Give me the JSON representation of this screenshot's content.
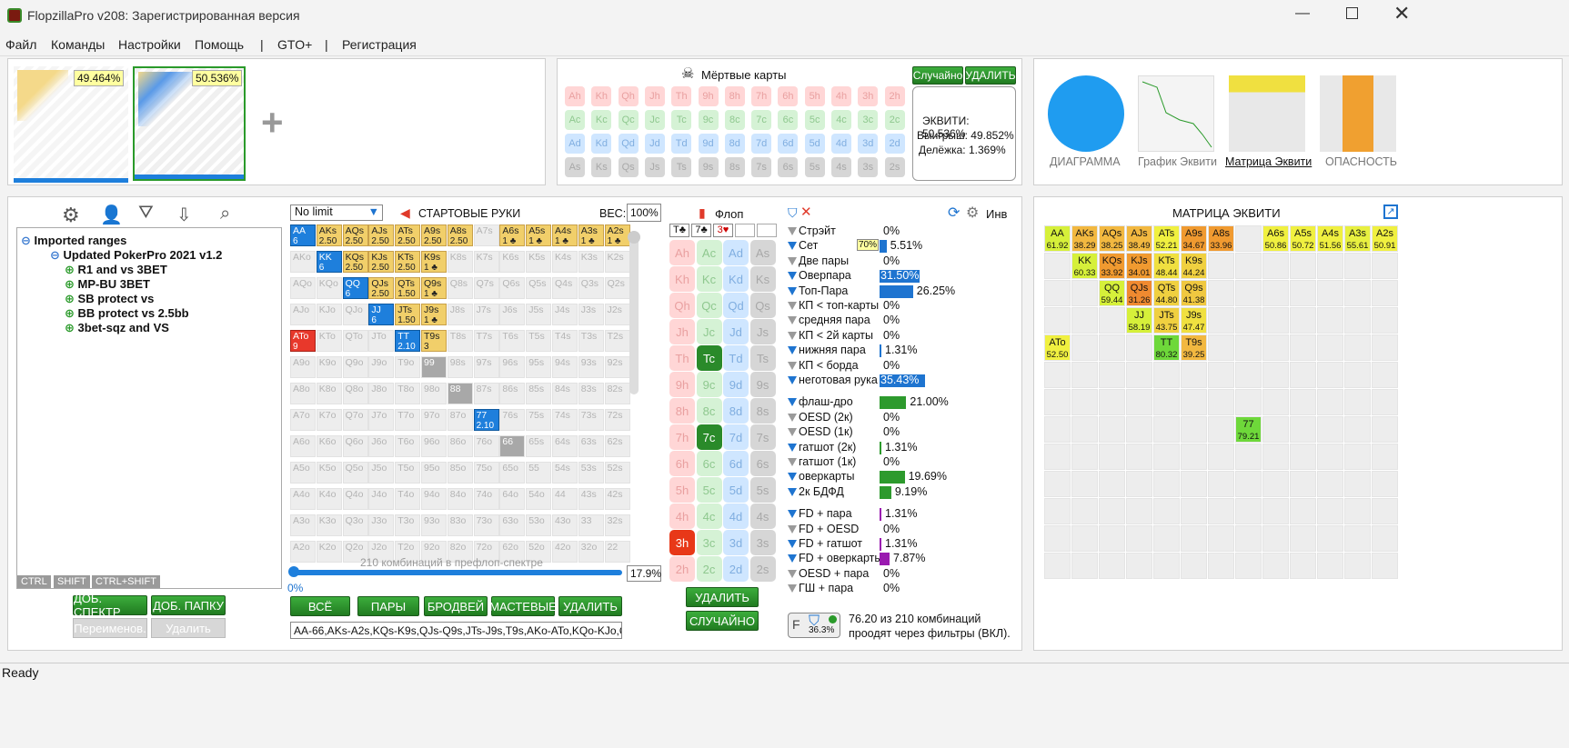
{
  "window": {
    "title": "FlopzillaPro v208: Зарегистрированная версия"
  },
  "menu": [
    "Файл",
    "Команды",
    "Настройки",
    "Помощь",
    "|",
    "GTO+",
    "|",
    "Регистрация"
  ],
  "players": [
    {
      "equity": "49.464%"
    },
    {
      "equity": "50.536%"
    }
  ],
  "dead": {
    "title": "Мёртвые карты",
    "random": "Случайно",
    "delete": "УДАЛИТЬ",
    "rows": [
      [
        "Ah",
        "Kh",
        "Qh",
        "Jh",
        "Th",
        "9h",
        "8h",
        "7h",
        "6h",
        "5h",
        "4h",
        "3h",
        "2h"
      ],
      [
        "Ac",
        "Kc",
        "Qc",
        "Jc",
        "Tc",
        "9c",
        "8c",
        "7c",
        "6c",
        "5c",
        "4c",
        "3c",
        "2c"
      ],
      [
        "Ad",
        "Kd",
        "Qd",
        "Jd",
        "Td",
        "9d",
        "8d",
        "7d",
        "6d",
        "5d",
        "4d",
        "3d",
        "2d"
      ],
      [
        "As",
        "Ks",
        "Qs",
        "Js",
        "Ts",
        "9s",
        "8s",
        "7s",
        "6s",
        "5s",
        "4s",
        "3s",
        "2s"
      ]
    ],
    "equity": "ЭКВИТИ: 50.536%",
    "win": "Выигрыш: 49.852%",
    "tie": "Делёжка: 1.369%"
  },
  "views": [
    "ДИАГРАММА",
    "График Эквити",
    "Матрица Эквити",
    "ОПАСНОСТЬ"
  ],
  "tree": {
    "items": [
      "Imported ranges",
      "Updated PokerPro 2021 v1.2",
      "R1 and vs 3BET",
      "MP-BU 3BET",
      "SB protect vs",
      "BB protect vs 2.5bb",
      "3bet-sqz and VS"
    ],
    "keys": [
      "CTRL",
      "SHIFT",
      "CTRL+SHIFT"
    ],
    "add_range": "ДОБ. СПЕКТР",
    "add_folder": "ДОБ. ПАПКУ",
    "rename": "Переименов.",
    "delete": "Удалить"
  },
  "range": {
    "mode": "No limit",
    "title": "СТАРТОВЫЕ РУКИ",
    "weight_label": "ВЕС:",
    "weight": "100%",
    "combos": "210 комбинаций в префлоп-спектре",
    "pct": "17.9%",
    "slider": "0%",
    "buttons": [
      "ВСЁ",
      "ПАРЫ",
      "БРОДВЕЙ",
      "МАСТЕВЫЕ",
      "УДАЛИТЬ"
    ],
    "text": "AA-66,AKs-A2s,KQs-K9s,QJs-Q9s,JTs-J9s,T9s,AKo-ATo,KQo-KJo,QJ",
    "grid": [
      [
        "AA",
        "AKs",
        "AQs",
        "AJs",
        "ATs",
        "A9s",
        "A8s",
        "A7s",
        "A6s",
        "A5s",
        "A4s",
        "A3s",
        "A2s"
      ],
      [
        "AKo",
        "KK",
        "KQs",
        "KJs",
        "KTs",
        "K9s",
        "K8s",
        "K7s",
        "K6s",
        "K5s",
        "K4s",
        "K3s",
        "K2s"
      ],
      [
        "AQo",
        "KQo",
        "QQ",
        "QJs",
        "QTs",
        "Q9s",
        "Q8s",
        "Q7s",
        "Q6s",
        "Q5s",
        "Q4s",
        "Q3s",
        "Q2s"
      ],
      [
        "AJo",
        "KJo",
        "QJo",
        "JJ",
        "JTs",
        "J9s",
        "J8s",
        "J7s",
        "J6s",
        "J5s",
        "J4s",
        "J3s",
        "J2s"
      ],
      [
        "ATo",
        "KTo",
        "QTo",
        "JTo",
        "TT",
        "T9s",
        "T8s",
        "T7s",
        "T6s",
        "T5s",
        "T4s",
        "T3s",
        "T2s"
      ],
      [
        "A9o",
        "K9o",
        "Q9o",
        "J9o",
        "T9o",
        "99",
        "98s",
        "97s",
        "96s",
        "95s",
        "94s",
        "93s",
        "92s"
      ],
      [
        "A8o",
        "K8o",
        "Q8o",
        "J8o",
        "T8o",
        "98o",
        "88",
        "87s",
        "86s",
        "85s",
        "84s",
        "83s",
        "82s"
      ],
      [
        "A7o",
        "K7o",
        "Q7o",
        "J7o",
        "T7o",
        "97o",
        "87o",
        "77",
        "76s",
        "75s",
        "74s",
        "73s",
        "72s"
      ],
      [
        "A6o",
        "K6o",
        "Q6o",
        "J6o",
        "T6o",
        "96o",
        "86o",
        "76o",
        "66",
        "65s",
        "64s",
        "63s",
        "62s"
      ],
      [
        "A5o",
        "K5o",
        "Q5o",
        "J5o",
        "T5o",
        "95o",
        "85o",
        "75o",
        "65o",
        "55",
        "54s",
        "53s",
        "52s"
      ],
      [
        "A4o",
        "K4o",
        "Q4o",
        "J4o",
        "T4o",
        "94o",
        "84o",
        "74o",
        "64o",
        "54o",
        "44",
        "43s",
        "42s"
      ],
      [
        "A3o",
        "K3o",
        "Q3o",
        "J3o",
        "T3o",
        "93o",
        "83o",
        "73o",
        "63o",
        "53o",
        "43o",
        "33",
        "32s"
      ],
      [
        "A2o",
        "K2o",
        "Q2o",
        "J2o",
        "T2o",
        "92o",
        "82o",
        "72o",
        "62o",
        "52o",
        "42o",
        "32o",
        "22"
      ]
    ],
    "weights": {
      "AA": "6",
      "AKs": "2.50",
      "AQs": "2.50",
      "AJs": "2.50",
      "ATs": "2.50",
      "A9s": "2.50",
      "A8s": "2.50",
      "A6s": "1 ♣",
      "A5s": "1 ♣",
      "A4s": "1 ♣",
      "A3s": "1 ♣",
      "A2s": "1 ♣",
      "KK": "6",
      "KQs": "2.50",
      "KJs": "2.50",
      "KTs": "2.50",
      "K9s": "1 ♣",
      "QQ": "6",
      "QJs": "2.50",
      "QTs": "1.50",
      "Q9s": "1 ♣",
      "JJ": "6",
      "JTs": "1.50",
      "J9s": "1 ♣",
      "ATo": "9",
      "TT": "2.10",
      "T9s": "3",
      "77": "2.10"
    }
  },
  "flop": {
    "title": "Флоп",
    "board": [
      "T♣",
      "7♣",
      "3♥"
    ],
    "delete": "УДАЛИТЬ",
    "random": "СЛУЧАЙНО",
    "ranks": [
      "A",
      "K",
      "Q",
      "J",
      "T",
      "9",
      "8",
      "7",
      "6",
      "5",
      "4",
      "3",
      "2"
    ]
  },
  "stats": {
    "header": "Инв",
    "filter_pct": "36.3%",
    "summary1": "76.20 из 210 комбинаций",
    "summary2": "проодят через фильтры (ВКЛ).",
    "rows": [
      {
        "label": "Стрэйт",
        "pct": "0%",
        "val": 0,
        "color": "#1e74d0"
      },
      {
        "label": "Сет",
        "pct": "5.51%",
        "val": 5.51,
        "color": "#1e74d0",
        "tag": "70%"
      },
      {
        "label": "Две пары",
        "pct": "0%",
        "val": 0,
        "color": "#1e74d0"
      },
      {
        "label": "Оверпара",
        "pct": "31.50%",
        "val": 31.5,
        "color": "#1e74d0",
        "inbar": true
      },
      {
        "label": "Топ-Пара",
        "pct": "26.25%",
        "val": 26.25,
        "color": "#1e74d0"
      },
      {
        "label": "КП < топ-карты",
        "pct": "0%",
        "val": 0,
        "color": "#1e74d0"
      },
      {
        "label": "средняя пара",
        "pct": "0%",
        "val": 0,
        "color": "#1e74d0"
      },
      {
        "label": "КП < 2й карты",
        "pct": "0%",
        "val": 0,
        "color": "#1e74d0"
      },
      {
        "label": "нижняя пара",
        "pct": "1.31%",
        "val": 1.31,
        "color": "#1e74d0"
      },
      {
        "label": "КП < борда",
        "pct": "0%",
        "val": 0,
        "color": "#1e74d0"
      },
      {
        "label": "неготовая рука",
        "pct": "35.43%",
        "val": 35.43,
        "color": "#1e74d0",
        "inbar": true
      },
      {
        "label": "флаш-дро",
        "pct": "21.00%",
        "val": 21,
        "color": "#2d9a2d"
      },
      {
        "label": "OESD (2к)",
        "pct": "0%",
        "val": 0,
        "color": "#2d9a2d"
      },
      {
        "label": "OESD (1к)",
        "pct": "0%",
        "val": 0,
        "color": "#2d9a2d"
      },
      {
        "label": "гатшот (2к)",
        "pct": "1.31%",
        "val": 1.31,
        "color": "#2d9a2d"
      },
      {
        "label": "гатшот (1к)",
        "pct": "0%",
        "val": 0,
        "color": "#2d9a2d"
      },
      {
        "label": "оверкарты",
        "pct": "19.69%",
        "val": 19.69,
        "color": "#2d9a2d"
      },
      {
        "label": "2к БДФД",
        "pct": "9.19%",
        "val": 9.19,
        "color": "#2d9a2d"
      },
      {
        "label": "FD + пара",
        "pct": "1.31%",
        "val": 1.31,
        "color": "#9a1ab0"
      },
      {
        "label": "FD + OESD",
        "pct": "0%",
        "val": 0,
        "color": "#9a1ab0"
      },
      {
        "label": "FD + гатшот",
        "pct": "1.31%",
        "val": 1.31,
        "color": "#9a1ab0"
      },
      {
        "label": "FD + оверкарты",
        "pct": "7.87%",
        "val": 7.87,
        "color": "#9a1ab0"
      },
      {
        "label": "OESD + пара",
        "pct": "0%",
        "val": 0,
        "color": "#9a1ab0"
      },
      {
        "label": "ГШ + пара",
        "pct": "0%",
        "val": 0,
        "color": "#9a1ab0"
      }
    ]
  },
  "matrix": {
    "title": "МАТРИЦА ЭКВИТИ",
    "cells": [
      {
        "h": "AA",
        "v": "61.92",
        "r": 0,
        "c": 0,
        "col": "#d6f03a"
      },
      {
        "h": "AKs",
        "v": "38.29",
        "r": 0,
        "c": 1,
        "col": "#f2b840"
      },
      {
        "h": "AQs",
        "v": "38.25",
        "r": 0,
        "c": 2,
        "col": "#f2b840"
      },
      {
        "h": "AJs",
        "v": "38.49",
        "r": 0,
        "c": 3,
        "col": "#f2b840"
      },
      {
        "h": "ATs",
        "v": "52.21",
        "r": 0,
        "c": 4,
        "col": "#f0f040"
      },
      {
        "h": "A9s",
        "v": "34.67",
        "r": 0,
        "c": 5,
        "col": "#f09a30"
      },
      {
        "h": "A8s",
        "v": "33.96",
        "r": 0,
        "c": 6,
        "col": "#f09a30"
      },
      {
        "h": "A6s",
        "v": "50.86",
        "r": 0,
        "c": 8,
        "col": "#f0f040"
      },
      {
        "h": "A5s",
        "v": "50.72",
        "r": 0,
        "c": 9,
        "col": "#f0f040"
      },
      {
        "h": "A4s",
        "v": "51.56",
        "r": 0,
        "c": 10,
        "col": "#f0f040"
      },
      {
        "h": "A3s",
        "v": "55.61",
        "r": 0,
        "c": 11,
        "col": "#e8f040"
      },
      {
        "h": "A2s",
        "v": "50.91",
        "r": 0,
        "c": 12,
        "col": "#f0f040"
      },
      {
        "h": "KK",
        "v": "60.33",
        "r": 1,
        "c": 1,
        "col": "#d6f03a"
      },
      {
        "h": "KQs",
        "v": "33.92",
        "r": 1,
        "c": 2,
        "col": "#f09a30"
      },
      {
        "h": "KJs",
        "v": "34.01",
        "r": 1,
        "c": 3,
        "col": "#f09a30"
      },
      {
        "h": "KTs",
        "v": "48.44",
        "r": 1,
        "c": 4,
        "col": "#f0e040"
      },
      {
        "h": "K9s",
        "v": "44.24",
        "r": 1,
        "c": 5,
        "col": "#f0d040"
      },
      {
        "h": "QQ",
        "v": "59.44",
        "r": 2,
        "c": 2,
        "col": "#d6f03a"
      },
      {
        "h": "QJs",
        "v": "31.26",
        "r": 2,
        "c": 3,
        "col": "#f08a30"
      },
      {
        "h": "QTs",
        "v": "44.80",
        "r": 2,
        "c": 4,
        "col": "#f0d040"
      },
      {
        "h": "Q9s",
        "v": "41.38",
        "r": 2,
        "c": 5,
        "col": "#f0c840"
      },
      {
        "h": "JJ",
        "v": "58.19",
        "r": 3,
        "c": 3,
        "col": "#d6f03a"
      },
      {
        "h": "JTs",
        "v": "43.75",
        "r": 3,
        "c": 4,
        "col": "#f0d040"
      },
      {
        "h": "J9s",
        "v": "47.47",
        "r": 3,
        "c": 5,
        "col": "#f0e040"
      },
      {
        "h": "ATo",
        "v": "52.50",
        "r": 4,
        "c": 0,
        "col": "#f0f040"
      },
      {
        "h": "TT",
        "v": "80.32",
        "r": 4,
        "c": 4,
        "col": "#6ed83a"
      },
      {
        "h": "T9s",
        "v": "39.25",
        "r": 4,
        "c": 5,
        "col": "#f2b840"
      },
      {
        "h": "77",
        "v": "79.21",
        "r": 7,
        "c": 7,
        "col": "#6ed83a"
      }
    ]
  },
  "status": "Ready"
}
